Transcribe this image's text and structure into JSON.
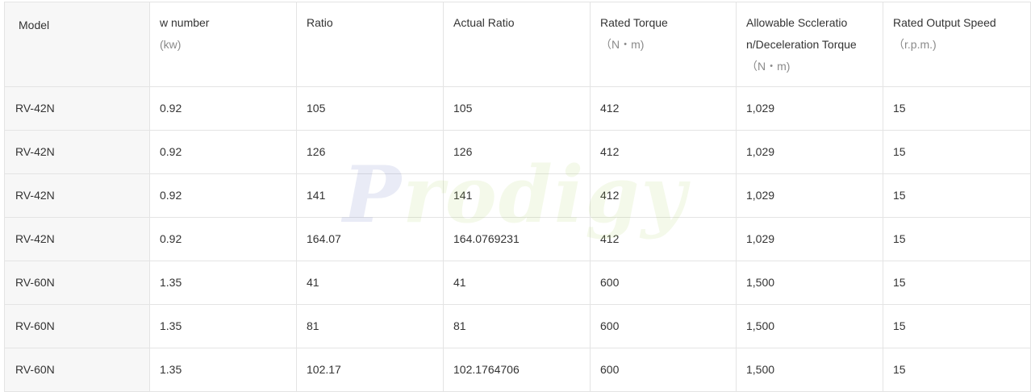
{
  "table": {
    "headers": [
      {
        "title": "Model",
        "unit": ""
      },
      {
        "title": "w number",
        "unit": "(kw)"
      },
      {
        "title": "Ratio",
        "unit": ""
      },
      {
        "title": "Actual Ratio",
        "unit": ""
      },
      {
        "title": "Rated Torque",
        "unit": "（N・m)"
      },
      {
        "title": "Allowable Sccelerationn/Deceleration Torque",
        "title_line1": "Allowable Sccleratio",
        "title_line2": "n/Deceleration Torque",
        "unit": "（N・m)"
      },
      {
        "title": "Rated Output Speed",
        "unit": "（r.p.m.)"
      }
    ],
    "rows": [
      [
        "RV-42N",
        "0.92",
        "105",
        "105",
        "412",
        "1,029",
        "15"
      ],
      [
        "RV-42N",
        "0.92",
        "126",
        "126",
        "412",
        "1,029",
        "15"
      ],
      [
        "RV-42N",
        "0.92",
        "141",
        "141",
        "412",
        "1,029",
        "15"
      ],
      [
        "RV-42N",
        "0.92",
        "164.07",
        "164.0769231",
        "412",
        "1,029",
        "15"
      ],
      [
        "RV-60N",
        "1.35",
        "41",
        "41",
        "600",
        "1,500",
        "15"
      ],
      [
        "RV-60N",
        "1.35",
        "81",
        "81",
        "600",
        "1,500",
        "15"
      ],
      [
        "RV-60N",
        "1.35",
        "102.17",
        "102.1764706",
        "600",
        "1,500",
        "15"
      ]
    ]
  },
  "watermark": {
    "first": "P",
    "rest": "rodigy"
  }
}
